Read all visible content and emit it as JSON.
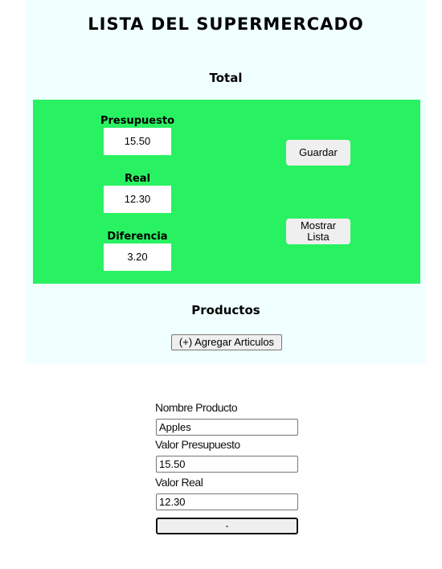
{
  "header": {
    "title": "LISTA DEL SUPERMERCADO",
    "total_heading": "Total"
  },
  "summary": {
    "budget_label": "Presupuesto",
    "budget_value": "15.50",
    "actual_label": "Real",
    "actual_value": "12.30",
    "difference_label": "Diferencia",
    "difference_value": "3.20",
    "save_label": "Guardar",
    "show_list_line1": "Mostrar",
    "show_list_line2": "Lista"
  },
  "products": {
    "heading": "Productos",
    "add_label": "(+) Agregar Articulos"
  },
  "item_form": {
    "name_label": "Nombre Producto",
    "name_value": "Apples",
    "budget_label": "Valor Presupuesto",
    "budget_value": "15.50",
    "actual_label": "Valor Real",
    "actual_value": "12.30",
    "remove_label": "-"
  },
  "colors": {
    "panel_bg": "#f0ffff",
    "summary_bg": "#29f262"
  }
}
